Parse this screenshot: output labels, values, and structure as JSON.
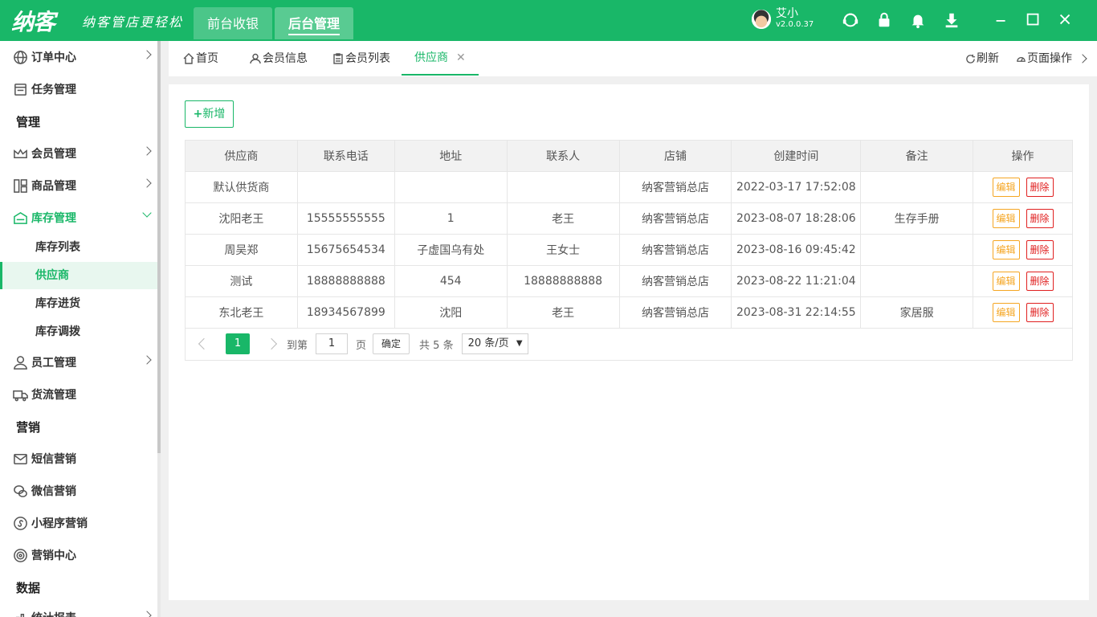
{
  "header": {
    "logo": "纳客",
    "slogan": "纳客管店更轻松",
    "nav": [
      {
        "label": "前台收银"
      },
      {
        "label": "后台管理"
      }
    ],
    "user": {
      "name": "艾小",
      "version": "v2.0.0.37"
    },
    "brand_color": "#19b768"
  },
  "sidebar": {
    "items": [
      {
        "label": "订单中心",
        "icon": "globe-icon"
      },
      {
        "label": "任务管理",
        "icon": "task-icon"
      },
      {
        "group": "管理"
      },
      {
        "label": "会员管理",
        "icon": "crown-icon"
      },
      {
        "label": "商品管理",
        "icon": "goods-icon"
      },
      {
        "label": "库存管理",
        "icon": "warehouse-icon"
      },
      {
        "label": "员工管理",
        "icon": "person-icon"
      },
      {
        "label": "货流管理",
        "icon": "truck-icon"
      },
      {
        "group": "营销"
      },
      {
        "label": "短信营销",
        "icon": "mail-icon"
      },
      {
        "label": "微信营销",
        "icon": "wechat-icon"
      },
      {
        "label": "小程序营销",
        "icon": "miniapp-icon"
      },
      {
        "label": "营销中心",
        "icon": "target-icon"
      },
      {
        "group": "数据"
      },
      {
        "label": "统计报表",
        "icon": "chart-icon"
      }
    ],
    "inventory_sub": [
      "库存列表",
      "供应商",
      "库存进货",
      "库存调拨"
    ]
  },
  "tabs": [
    {
      "label": "首页",
      "icon": "home-icon"
    },
    {
      "label": "会员信息",
      "icon": "user-icon"
    },
    {
      "label": "会员列表",
      "icon": "clipboard-icon"
    },
    {
      "label": "供应商",
      "icon": ""
    }
  ],
  "tab_ops": {
    "refresh": "刷新",
    "page_ops": "页面操作"
  },
  "toolbar": {
    "add_label": "新增"
  },
  "table": {
    "columns": [
      "供应商",
      "联系电话",
      "地址",
      "联系人",
      "店铺",
      "创建时间",
      "备注",
      "操作"
    ],
    "rows": [
      [
        "默认供货商",
        "",
        "",
        "",
        "纳客营销总店",
        "2022-03-17 17:52:08",
        ""
      ],
      [
        "沈阳老王",
        "15555555555",
        "1",
        "老王",
        "纳客营销总店",
        "2023-08-07 18:28:06",
        "生存手册"
      ],
      [
        "周吴郑",
        "15675654534",
        "子虚国乌有处",
        "王女士",
        "纳客营销总店",
        "2023-08-16 09:45:42",
        ""
      ],
      [
        "测试",
        "18888888888",
        "454",
        "18888888888",
        "纳客营销总店",
        "2023-08-22 11:21:04",
        ""
      ],
      [
        "东北老王",
        "18934567899",
        "沈阳",
        "老王",
        "纳客营销总店",
        "2023-08-31 22:14:55",
        "家居服"
      ]
    ],
    "edit_label": "编辑",
    "delete_label": "删除"
  },
  "pager": {
    "current": "1",
    "goto_label": "到第",
    "page_input": "1",
    "page_unit": "页",
    "confirm": "确定",
    "total": "共 5 条",
    "page_size": "20 条/页"
  }
}
